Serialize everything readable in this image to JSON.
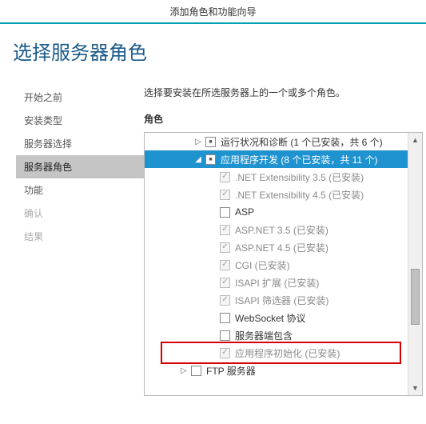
{
  "window": {
    "title": "添加角色和功能向导"
  },
  "page": {
    "title": "选择服务器角色"
  },
  "sidebar": {
    "items": [
      {
        "label": "开始之前",
        "state": "normal"
      },
      {
        "label": "安装类型",
        "state": "normal"
      },
      {
        "label": "服务器选择",
        "state": "normal"
      },
      {
        "label": "服务器角色",
        "state": "selected"
      },
      {
        "label": "功能",
        "state": "normal"
      },
      {
        "label": "确认",
        "state": "disabled"
      },
      {
        "label": "结果",
        "state": "disabled"
      }
    ]
  },
  "main": {
    "instruction": "选择要安装在所选服务器上的一个或多个角色。",
    "section_label": "角色",
    "tree": [
      {
        "indent": 2,
        "expander": "right",
        "check": "mixed",
        "label": "运行状况和诊断 (1 个已安装，共 6 个)",
        "disabled": false,
        "selected": false
      },
      {
        "indent": 2,
        "expander": "down",
        "check": "mixed",
        "label": "应用程序开发 (8 个已安装，共 11 个)",
        "disabled": false,
        "selected": true
      },
      {
        "indent": 3,
        "expander": "",
        "check": "checked-disabled",
        "label": ".NET Extensibility 3.5 (已安装)",
        "disabled": true,
        "selected": false
      },
      {
        "indent": 3,
        "expander": "",
        "check": "checked-disabled",
        "label": ".NET Extensibility 4.5 (已安装)",
        "disabled": true,
        "selected": false
      },
      {
        "indent": 3,
        "expander": "",
        "check": "none",
        "label": "ASP",
        "disabled": false,
        "selected": false
      },
      {
        "indent": 3,
        "expander": "",
        "check": "checked-disabled",
        "label": "ASP.NET 3.5 (已安装)",
        "disabled": true,
        "selected": false
      },
      {
        "indent": 3,
        "expander": "",
        "check": "checked-disabled",
        "label": "ASP.NET 4.5 (已安装)",
        "disabled": true,
        "selected": false
      },
      {
        "indent": 3,
        "expander": "",
        "check": "checked-disabled",
        "label": "CGI (已安装)",
        "disabled": true,
        "selected": false
      },
      {
        "indent": 3,
        "expander": "",
        "check": "checked-disabled",
        "label": "ISAPI 扩展 (已安装)",
        "disabled": true,
        "selected": false
      },
      {
        "indent": 3,
        "expander": "",
        "check": "checked-disabled",
        "label": "ISAPI 筛选器 (已安装)",
        "disabled": true,
        "selected": false
      },
      {
        "indent": 3,
        "expander": "",
        "check": "none",
        "label": "WebSocket 协议",
        "disabled": false,
        "selected": false
      },
      {
        "indent": 3,
        "expander": "",
        "check": "none",
        "label": "服务器端包含",
        "disabled": false,
        "selected": false
      },
      {
        "indent": 3,
        "expander": "",
        "check": "checked-disabled",
        "label": "应用程序初始化 (已安装)",
        "disabled": true,
        "selected": false,
        "highlight": true
      },
      {
        "indent": 1,
        "expander": "right",
        "check": "none",
        "label": "FTP 服务器",
        "disabled": false,
        "selected": false
      }
    ]
  }
}
